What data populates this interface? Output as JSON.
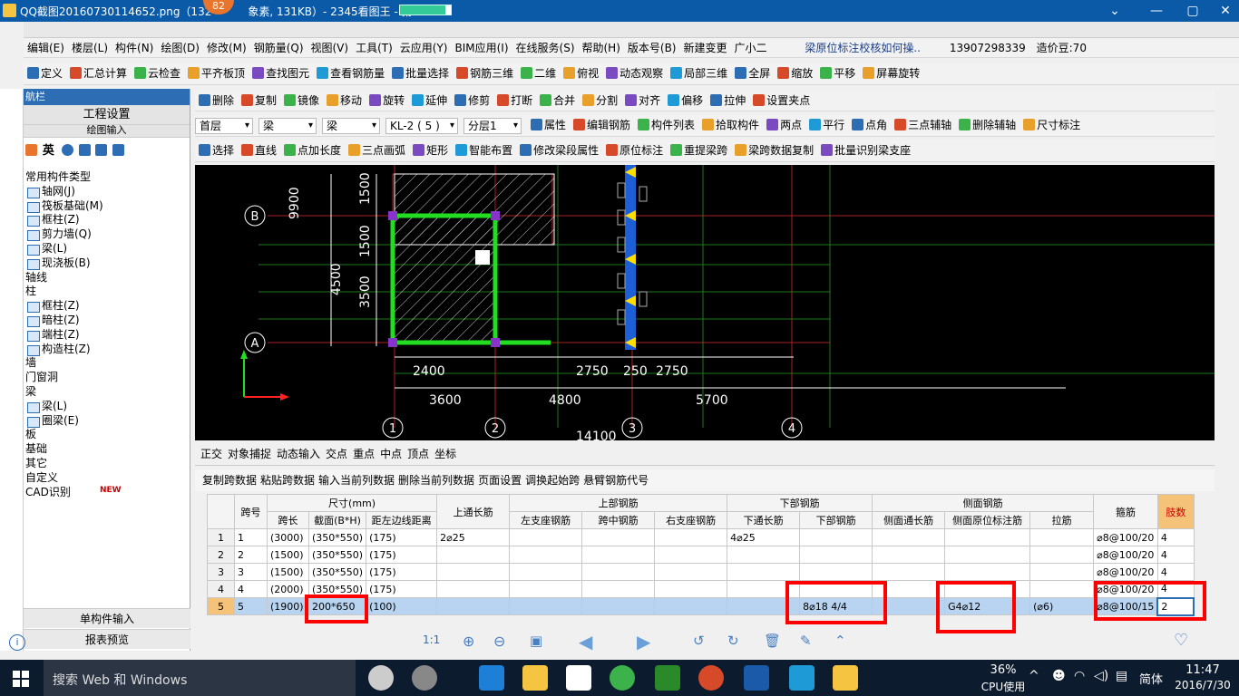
{
  "window": {
    "title": "QQ截图20160730114652.png（132",
    "badge": "82",
    "title_rest": "象素, 131KB）- 2345看图王 - 第1",
    "progress": 0.9
  },
  "menu": [
    "编辑(E)",
    "楼层(L)",
    "构件(N)",
    "绘图(D)",
    "修改(M)",
    "钢筋量(Q)",
    "视图(V)",
    "工具(T)",
    "云应用(Y)",
    "BIM应用(I)",
    "在线服务(S)",
    "帮助(H)",
    "版本号(B)",
    "新建变更",
    "广小二"
  ],
  "menu_right": {
    "tip": "梁原位标注校核如何操..",
    "phone": "13907298339",
    "coins": "造价豆:70"
  },
  "toolbar1": [
    "定义",
    "汇总计算",
    "云检查",
    "平齐板顶",
    "查找图元",
    "查看钢筋量",
    "批量选择",
    "钢筋三维",
    "二维",
    "俯视",
    "动态观察",
    "局部三维",
    "全屏",
    "缩放",
    "平移",
    "屏幕旋转"
  ],
  "toolbar2": [
    "删除",
    "复制",
    "镜像",
    "移动",
    "旋转",
    "延伸",
    "修剪",
    "打断",
    "合并",
    "分割",
    "对齐",
    "偏移",
    "拉伸",
    "设置夹点"
  ],
  "toolbar3": {
    "combos": [
      "首层",
      "梁",
      "梁",
      "KL-2 ( 5 )",
      "分层1"
    ],
    "items": [
      "属性",
      "编辑钢筋",
      "构件列表",
      "拾取构件",
      "两点",
      "平行",
      "点角",
      "三点辅轴",
      "删除辅轴",
      "尺寸标注"
    ]
  },
  "toolbar4": [
    "选择",
    "直线",
    "点加长度",
    "三点画弧",
    "矩形",
    "智能布置",
    "修改梁段属性",
    "原位标注",
    "重提梁跨",
    "梁跨数据复制",
    "批量识别梁支座"
  ],
  "leftpanel": {
    "header": "航栏",
    "section": "工程设置",
    "section2": "绘图输入",
    "tree": [
      {
        "t": "常用构件类型",
        "sub": false
      },
      {
        "t": "轴网(J)",
        "sub": true
      },
      {
        "t": "筏板基础(M)",
        "sub": true
      },
      {
        "t": "框柱(Z)",
        "sub": true
      },
      {
        "t": "剪力墙(Q)",
        "sub": true
      },
      {
        "t": "梁(L)",
        "sub": true
      },
      {
        "t": "现浇板(B)",
        "sub": true
      },
      {
        "t": "轴线",
        "sub": false
      },
      {
        "t": "柱",
        "sub": false
      },
      {
        "t": "框柱(Z)",
        "sub": true
      },
      {
        "t": "暗柱(Z)",
        "sub": true
      },
      {
        "t": "端柱(Z)",
        "sub": true
      },
      {
        "t": "构造柱(Z)",
        "sub": true
      },
      {
        "t": "墙",
        "sub": false
      },
      {
        "t": "门窗洞",
        "sub": false
      },
      {
        "t": "梁",
        "sub": false
      },
      {
        "t": "梁(L)",
        "sub": true
      },
      {
        "t": "圈梁(E)",
        "sub": true
      },
      {
        "t": "板",
        "sub": false
      },
      {
        "t": "基础",
        "sub": false
      },
      {
        "t": "其它",
        "sub": false
      },
      {
        "t": "自定义",
        "sub": false
      },
      {
        "t": "CAD识别",
        "sub": false
      }
    ],
    "new_tag": "NEW",
    "btn1": "单构件输入",
    "btn2": "报表预览"
  },
  "cad": {
    "dims_v": [
      "9900",
      "1500",
      "1500",
      "4500",
      "3500"
    ],
    "dims_h1": [
      "2400",
      "2750",
      "250",
      "2750"
    ],
    "dims_h2": [
      "3600",
      "4800",
      "5700"
    ],
    "dim_bottom": "14100",
    "axes_left": [
      "B",
      "A"
    ],
    "axes_bottom": [
      "1",
      "2",
      "3",
      "4"
    ]
  },
  "snapbar": [
    "正交",
    "对象捕捉",
    "动态输入",
    "交点",
    "重点",
    "中点",
    "顶点",
    "坐标"
  ],
  "gridtools": [
    "复制跨数据",
    "粘贴跨数据",
    "输入当前列数据",
    "删除当前列数据",
    "页面设置",
    "调换起始跨",
    "悬臂钢筋代号"
  ],
  "grid": {
    "h_span": "跨号",
    "h_size": "尺寸(mm)",
    "h_top_long": "上通长筋",
    "h_top": "上部钢筋",
    "h_bot": "下部钢筋",
    "h_side": "侧面钢筋",
    "h_stirrup": "箍筋",
    "h_legs": "肢数",
    "sub": [
      "跨长",
      "截面(B*H)",
      "距左边线距离",
      "左支座钢筋",
      "跨中钢筋",
      "右支座钢筋",
      "下通长筋",
      "下部钢筋",
      "侧面通长筋",
      "侧面原位标注筋",
      "拉筋"
    ],
    "rows": [
      {
        "n": "1",
        "span": "1",
        "len": "(3000)",
        "sec": "(350*550)",
        "dist": "(175)",
        "topl": "2⌀25",
        "bl": "4⌀25",
        "bot": "",
        "sidep": "",
        "tie": "",
        "stir": "⌀8@100/20",
        "legs": "4"
      },
      {
        "n": "2",
        "span": "2",
        "len": "(1500)",
        "sec": "(350*550)",
        "dist": "(175)",
        "topl": "",
        "bl": "",
        "bot": "",
        "sidep": "",
        "tie": "",
        "stir": "⌀8@100/20",
        "legs": "4"
      },
      {
        "n": "3",
        "span": "3",
        "len": "(1500)",
        "sec": "(350*550)",
        "dist": "(175)",
        "topl": "",
        "bl": "",
        "bot": "",
        "sidep": "",
        "tie": "",
        "stir": "⌀8@100/20",
        "legs": "4"
      },
      {
        "n": "4",
        "span": "4",
        "len": "(2000)",
        "sec": "(350*550)",
        "dist": "(175)",
        "topl": "",
        "bl": "",
        "bot": "",
        "sidep": "",
        "tie": "",
        "stir": "⌀8@100/20",
        "legs": "4"
      },
      {
        "n": "5",
        "span": "5",
        "len": "(1900)",
        "sec": "200*650",
        "dist": "(100)",
        "topl": "",
        "bl": "",
        "bot": "8⌀18 4/4",
        "sidep": "G4⌀12",
        "tie": "(⌀6)",
        "stir": "⌀8@100/15",
        "legs": "2"
      }
    ]
  },
  "zoom": "1:1",
  "taskbar": {
    "search": "搜索 Web 和 Windows",
    "cpu": "36%",
    "cpu_label": "CPU使用",
    "ime": "简体",
    "time": "11:47",
    "date": "2016/7/30"
  },
  "colors": {
    "accent": "#0a5aa8",
    "beam": "#22dd22",
    "highlight": "#ff0000",
    "selrow": "#b8d4f0"
  }
}
